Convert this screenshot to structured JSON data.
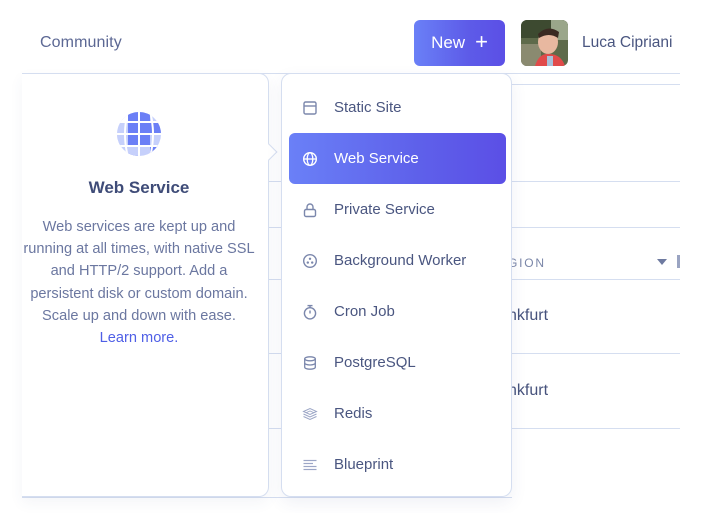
{
  "header": {
    "nav_link": "Community",
    "new_button": {
      "label": "New",
      "icon": "plus-icon"
    },
    "user": {
      "name": "Luca Cipriani",
      "avatar": "user-photo"
    }
  },
  "background_table": {
    "column_header": "GION",
    "rows": [
      {
        "region": "nkfurt"
      },
      {
        "region": "nkfurt"
      }
    ]
  },
  "description_panel": {
    "icon": "globe-icon",
    "title": "Web Service",
    "body": "Web services are kept up and running at all times, with native SSL and HTTP/2 support. Add a persistent disk or custom domain. Scale up and down with ease.",
    "link": "Learn more."
  },
  "new_menu": {
    "selected": "Web Service",
    "items": [
      {
        "label": "Static Site",
        "icon": "browser-window-icon"
      },
      {
        "label": "Web Service",
        "icon": "globe-icon",
        "active": true
      },
      {
        "label": "Private Service",
        "icon": "lock-icon"
      },
      {
        "label": "Background Worker",
        "icon": "worker-circle-icon"
      },
      {
        "label": "Cron Job",
        "icon": "stopwatch-icon"
      },
      {
        "label": "PostgreSQL",
        "icon": "database-icon"
      },
      {
        "label": "Redis",
        "icon": "layers-icon"
      },
      {
        "label": "Blueprint",
        "icon": "lines-icon"
      }
    ]
  },
  "colors": {
    "accent_start": "#6a80f7",
    "accent_end": "#5b4fe6",
    "text": "#4a5680",
    "link": "#4f5fe6",
    "border": "#d5def0"
  }
}
